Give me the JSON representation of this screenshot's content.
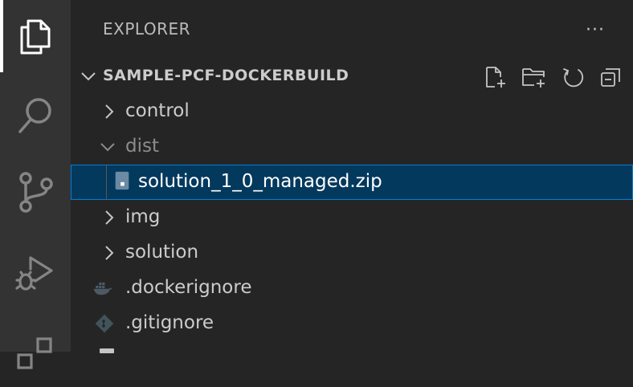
{
  "activity_bar": {
    "items": [
      {
        "icon": "files-icon",
        "active": true
      },
      {
        "icon": "search-icon",
        "active": false
      },
      {
        "icon": "source-control-icon",
        "active": false
      },
      {
        "icon": "run-debug-icon",
        "active": false
      },
      {
        "icon": "extensions-icon",
        "active": false
      }
    ]
  },
  "sidebar": {
    "title": "EXPLORER",
    "more_label": "···",
    "section": {
      "title": "SAMPLE-PCF-DOCKERBUILD",
      "actions": [
        "new-file-icon",
        "new-folder-icon",
        "refresh-icon",
        "collapse-all-icon"
      ]
    },
    "tree": [
      {
        "label": "control",
        "type": "folder",
        "expanded": false
      },
      {
        "label": "dist",
        "type": "folder",
        "expanded": true
      },
      {
        "label": "solution_1_0_managed.zip",
        "type": "file",
        "icon": "zip-file-icon",
        "selected": true
      },
      {
        "label": "img",
        "type": "folder",
        "expanded": false
      },
      {
        "label": "solution",
        "type": "folder",
        "expanded": false
      },
      {
        "label": ".dockerignore",
        "type": "file",
        "icon": "docker-icon"
      },
      {
        "label": ".gitignore",
        "type": "file",
        "icon": "git-icon"
      }
    ]
  },
  "colors": {
    "activity_bar_bg": "#333333",
    "sidebar_bg": "#252526",
    "selection_bg": "#04395e",
    "selection_border": "#007fd4",
    "text": "#cccccc",
    "muted_text": "#8c8c8c"
  }
}
